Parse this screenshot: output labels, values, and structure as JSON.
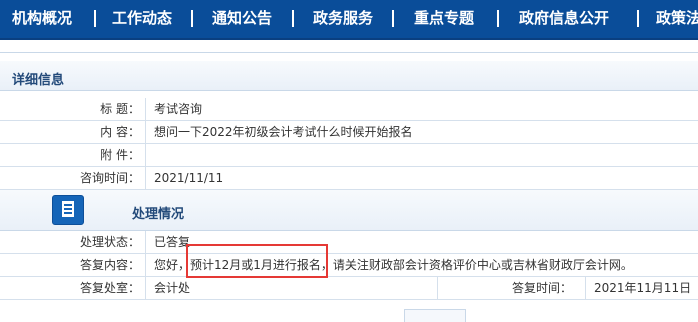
{
  "nav": {
    "items": [
      "机构概况",
      "工作动态",
      "通知公告",
      "政务服务",
      "重点专题",
      "政府信息公开",
      "政策法"
    ]
  },
  "detail": {
    "section_title": "详细信息",
    "rows": [
      {
        "label": "标  题：",
        "value": "考试咨询"
      },
      {
        "label": "内  容：",
        "value": "想问一下2022年初级会计考试什么时候开始报名"
      },
      {
        "label": "附  件：",
        "value": ""
      },
      {
        "label": "咨询时间：",
        "value": "2021/11/11"
      }
    ]
  },
  "processing": {
    "section_title": "处理情况",
    "icon": "document-icon",
    "status_label": "处理状态：",
    "status_value": "已答复",
    "reply_label": "答复内容：",
    "reply_value": "您好，预计12月或1月进行报名，请关注财政部会计资格评价中心或吉林省财政厅会计网。",
    "office_label": "答复处室：",
    "office_value": "会计处",
    "time_label": "答复时间：",
    "time_value": "2021年11月11日"
  },
  "colors": {
    "nav_bg": "#0a4d99",
    "highlight": "#e53935",
    "section_title": "#234a7a"
  }
}
